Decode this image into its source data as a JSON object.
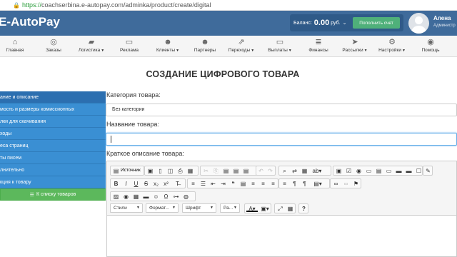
{
  "browser": {
    "scheme": "https://",
    "url": "coachserbina.e-autopay.com/adminka/product/create/digital"
  },
  "header": {
    "logo": "E-AutoPay",
    "balance_label": "Баланс:",
    "balance_value": "0.00",
    "currency": "руб.",
    "topup_button": "Пополнить счет",
    "user_name": "Алена",
    "user_role": "Администр"
  },
  "nav": [
    {
      "label": "Главная",
      "icon": "home-icon",
      "dropdown": false
    },
    {
      "label": "Заказы",
      "icon": "coins-icon",
      "dropdown": false
    },
    {
      "label": "Логистика",
      "icon": "truck-icon",
      "dropdown": true
    },
    {
      "label": "Реклама",
      "icon": "monitor-icon",
      "dropdown": false
    },
    {
      "label": "Клиенты",
      "icon": "users-icon",
      "dropdown": true
    },
    {
      "label": "Партнеры",
      "icon": "partners-icon",
      "dropdown": false
    },
    {
      "label": "Переходы",
      "icon": "share-icon",
      "dropdown": true
    },
    {
      "label": "Выплаты",
      "icon": "card-icon",
      "dropdown": true
    },
    {
      "label": "Финансы",
      "icon": "database-icon",
      "dropdown": false
    },
    {
      "label": "Рассылки",
      "icon": "send-icon",
      "dropdown": true
    },
    {
      "label": "Настройки",
      "icon": "gear-icon",
      "dropdown": true
    },
    {
      "label": "Помощь",
      "icon": "help-icon",
      "dropdown": false
    }
  ],
  "page_title": "СОЗДАНИЕ ЦИФРОВОГО ТОВАРА",
  "sidebar": {
    "items": [
      "ание и описание",
      "мость и размеры комиссионных",
      "лки для скачивания",
      "ходы",
      "еса страниц",
      "ты писем",
      "лнительно",
      "кция к товару"
    ],
    "back_button": "К списку товаров"
  },
  "form": {
    "category_label": "Категория товара:",
    "category_value": "Без категории",
    "name_label": "Название товара:",
    "name_value": "",
    "short_desc_label": "Краткое описание товара:"
  },
  "editor": {
    "source_label": "Источник",
    "styles": "Стили",
    "format": "Формат...",
    "font": "Шрифт",
    "size": "Ра..."
  },
  "colors": {
    "brand": "#3f6b9b",
    "sidebar": "#3a8fd3",
    "back_button": "#5cb85c",
    "topup": "#4fb07a"
  }
}
